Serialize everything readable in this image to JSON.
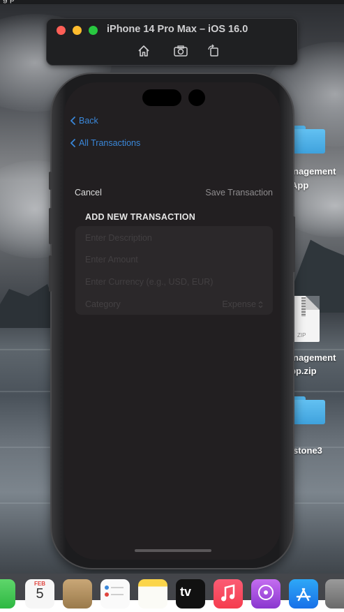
{
  "menubar": {
    "text": "g            p"
  },
  "simulator": {
    "title": "iPhone 14 Pro Max – iOS 16.0",
    "tools": [
      "home-icon",
      "screenshot-icon",
      "rotate-icon"
    ]
  },
  "desktop": {
    "items": [
      {
        "label": "nagement",
        "label2": "App",
        "icon": "folder-icon"
      },
      {
        "label": "nagement",
        "label2": "pp.zip",
        "icon": "zip-file-icon",
        "badge": "ZIP"
      },
      {
        "label": "stone3",
        "icon": "folder-icon"
      }
    ]
  },
  "app": {
    "nav": {
      "back_label": "Back",
      "all_transactions_label": "All Transactions"
    },
    "toolbar": {
      "cancel_label": "Cancel",
      "save_label": "Save Transaction"
    },
    "form": {
      "section_title": "ADD NEW TRANSACTION",
      "description": {
        "value": "",
        "placeholder": "Enter Description"
      },
      "amount": {
        "value": "",
        "placeholder": "Enter Amount"
      },
      "currency": {
        "value": "",
        "placeholder": "Enter Currency (e.g., USD, EUR)"
      },
      "category": {
        "label": "Category",
        "value": "Expense",
        "icon": "chevron-updown-icon"
      }
    }
  },
  "dock": {
    "calendar": {
      "month": "FEB",
      "day": "5"
    },
    "tv_label": "tv",
    "apps": [
      "facetime-icon",
      "calendar-icon",
      "contacts-icon",
      "reminders-icon",
      "notes-icon",
      "tv-icon",
      "music-icon",
      "podcasts-icon",
      "app-store-icon",
      "system-settings-icon"
    ]
  },
  "colors": {
    "accent": "#3a87d9",
    "screen_bg": "#221f21",
    "form_bg": "#2b282a"
  }
}
